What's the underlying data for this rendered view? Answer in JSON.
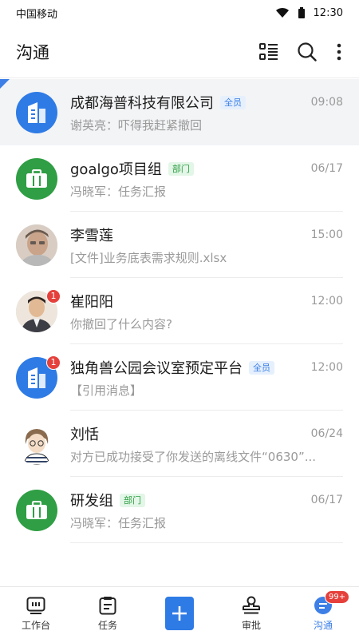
{
  "status_bar": {
    "carrier": "中国移动",
    "time": "12:30"
  },
  "header": {
    "title": "沟通"
  },
  "conversations": [
    {
      "name": "成都海普科技有限公司",
      "tag": "全员",
      "tag_color": "blue",
      "time": "09:08",
      "preview": "谢英亮：吓得我赶紧撤回",
      "avatar": "building-icon",
      "pinned": true,
      "unread": ""
    },
    {
      "name": "goalgo项目组",
      "tag": "部门",
      "tag_color": "green",
      "time": "06/17",
      "preview": "冯晓军：任务汇报",
      "avatar": "briefcase-icon",
      "pinned": false,
      "unread": ""
    },
    {
      "name": "李雪莲",
      "tag": "",
      "tag_color": "",
      "time": "15:00",
      "preview": "[文件]业务底表需求规则.xlsx",
      "avatar": "user-photo",
      "pinned": false,
      "unread": ""
    },
    {
      "name": "崔阳阳",
      "tag": "",
      "tag_color": "",
      "time": "12:00",
      "preview": "你撤回了什么内容?",
      "avatar": "user-photo",
      "pinned": false,
      "unread": "1"
    },
    {
      "name": "独角兽公园会议室预定平台",
      "tag": "全员",
      "tag_color": "blue",
      "time": "12:00",
      "preview": "【引用消息】",
      "avatar": "building-icon",
      "pinned": false,
      "unread": "1"
    },
    {
      "name": "刘恬",
      "tag": "",
      "tag_color": "",
      "time": "06/24",
      "preview": "对方已成功接受了你发送的离线文件“0630”...",
      "avatar": "user-illustration",
      "pinned": false,
      "unread": ""
    },
    {
      "name": "研发组",
      "tag": "部门",
      "tag_color": "green",
      "time": "06/17",
      "preview": "冯晓军：任务汇报",
      "avatar": "briefcase-icon",
      "pinned": false,
      "unread": ""
    }
  ],
  "tabbar": {
    "workbench": "工作台",
    "tasks": "任务",
    "approval": "审批",
    "chat": "沟通",
    "chat_badge": "99+"
  },
  "colors": {
    "accent": "#2f7be5",
    "green": "#2f9e44",
    "badge": "#e5403b"
  }
}
